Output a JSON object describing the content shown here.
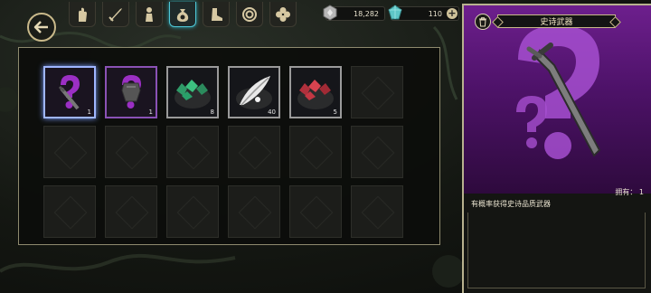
{
  "tabs": [
    {
      "icon": "hand-icon"
    },
    {
      "icon": "sword-icon"
    },
    {
      "icon": "figure-icon"
    },
    {
      "icon": "money-bag-icon",
      "active": true
    },
    {
      "icon": "boot-icon"
    },
    {
      "icon": "target-icon"
    },
    {
      "icon": "clover-icon"
    }
  ],
  "currency": {
    "silver": "18,282",
    "gems": "110"
  },
  "inventory": {
    "rows": [
      [
        {
          "item": "epic-weapon",
          "count": "1",
          "rarity": "epic",
          "selected": true
        },
        {
          "item": "epic-armor",
          "count": "1",
          "rarity": "epic"
        },
        {
          "item": "green-ore",
          "count": "8",
          "rarity": "common"
        },
        {
          "item": "white-feather",
          "count": "40",
          "rarity": "common"
        },
        {
          "item": "red-ore",
          "count": "5",
          "rarity": "common"
        },
        {
          "item": null
        }
      ],
      [
        {
          "item": null
        },
        {
          "item": null
        },
        {
          "item": null
        },
        {
          "item": null
        },
        {
          "item": null
        },
        {
          "item": null
        }
      ],
      [
        {
          "item": null
        },
        {
          "item": null
        },
        {
          "item": null
        },
        {
          "item": null
        },
        {
          "item": null
        },
        {
          "item": null
        }
      ]
    ]
  },
  "detail": {
    "title": "史诗武器",
    "owned_label": "拥有：",
    "owned_count": "1",
    "description": "有概率获得史诗品质武器"
  },
  "colors": {
    "epic": "#9b2fc4",
    "accent_teal": "#4fc7d6",
    "frame_gold": "#c9b98a"
  }
}
